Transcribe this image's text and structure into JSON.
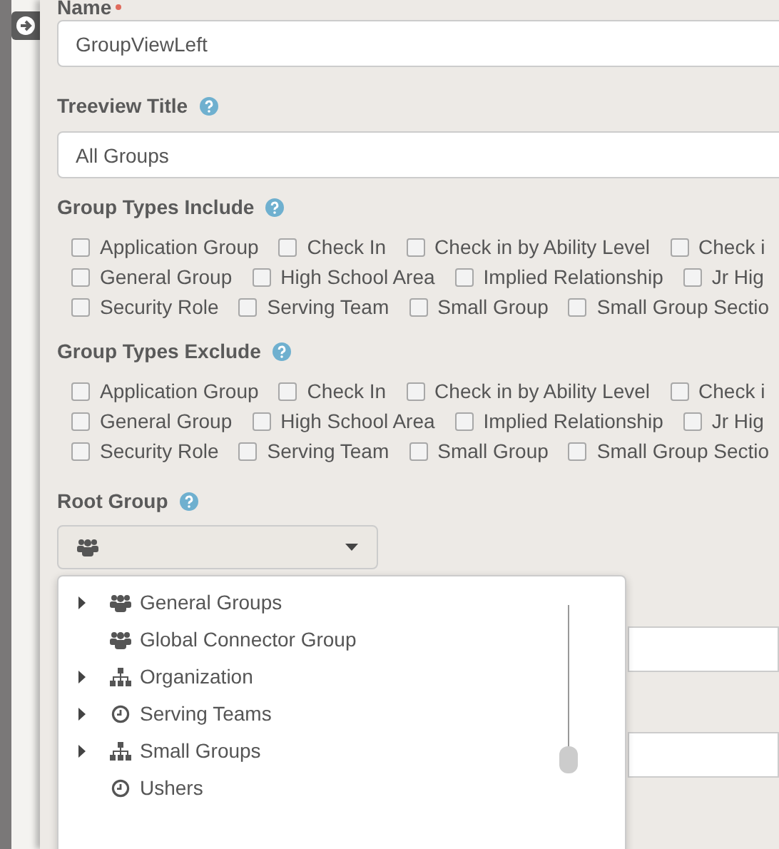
{
  "name_field": {
    "label": "Name",
    "required": true,
    "value": "GroupViewLeft"
  },
  "treeview_title": {
    "label": "Treeview Title",
    "value": "All Groups"
  },
  "group_types_include": {
    "label": "Group Types Include",
    "rows": [
      [
        {
          "label": "Application Group",
          "checked": false
        },
        {
          "label": "Check In",
          "checked": false
        },
        {
          "label": "Check in by Ability Level",
          "checked": false
        },
        {
          "label": "Check i",
          "checked": false
        }
      ],
      [
        {
          "label": "General Group",
          "checked": false
        },
        {
          "label": "High School Area",
          "checked": false
        },
        {
          "label": "Implied Relationship",
          "checked": false
        },
        {
          "label": "Jr Hig",
          "checked": false
        }
      ],
      [
        {
          "label": "Security Role",
          "checked": false
        },
        {
          "label": "Serving Team",
          "checked": false
        },
        {
          "label": "Small Group",
          "checked": false
        },
        {
          "label": "Small Group Sectio",
          "checked": false
        }
      ]
    ]
  },
  "group_types_exclude": {
    "label": "Group Types Exclude",
    "rows": [
      [
        {
          "label": "Application Group",
          "checked": false
        },
        {
          "label": "Check In",
          "checked": false
        },
        {
          "label": "Check in by Ability Level",
          "checked": false
        },
        {
          "label": "Check i",
          "checked": false
        }
      ],
      [
        {
          "label": "General Group",
          "checked": false
        },
        {
          "label": "High School Area",
          "checked": false
        },
        {
          "label": "Implied Relationship",
          "checked": false
        },
        {
          "label": "Jr Hig",
          "checked": false
        }
      ],
      [
        {
          "label": "Security Role",
          "checked": false
        },
        {
          "label": "Serving Team",
          "checked": false
        },
        {
          "label": "Small Group",
          "checked": false
        },
        {
          "label": "Small Group Sectio",
          "checked": false
        }
      ]
    ]
  },
  "root_group": {
    "label": "Root Group",
    "expanded": true,
    "items": [
      {
        "label": "General Groups",
        "kind": "group",
        "has_children": true
      },
      {
        "label": "Global Connector Group",
        "kind": "group",
        "has_children": false
      },
      {
        "label": "Organization",
        "kind": "hierarchy",
        "has_children": true
      },
      {
        "label": "Serving Teams",
        "kind": "clock",
        "has_children": true
      },
      {
        "label": "Small Groups",
        "kind": "hierarchy",
        "has_children": true
      },
      {
        "label": "Ushers",
        "kind": "clock",
        "has_children": false
      }
    ]
  }
}
